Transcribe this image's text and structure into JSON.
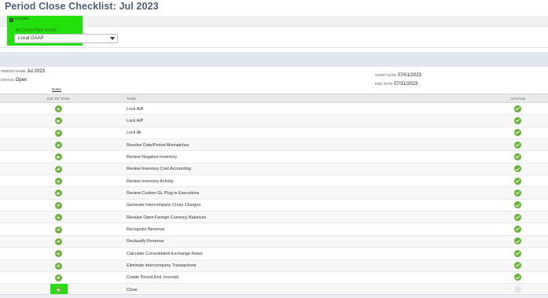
{
  "page": {
    "title": "Period Close Checklist: Jul 2023"
  },
  "filters": {
    "toggle_label": "FILTERS",
    "accounting_book_label": "ACCOUNTING BOOK",
    "accounting_book_value": "Local GAAP",
    "highlight_color": "#22e00c"
  },
  "period": {
    "name_label": "PERIOD NAME",
    "name_value": "Jul 2023",
    "status_label": "STATUS",
    "status_value": "Open",
    "start_label": "START DATE",
    "start_value": "07/01/2023",
    "end_label": "END DATE",
    "end_value": "07/31/2023",
    "notes_label": "Notes"
  },
  "table": {
    "headers": {
      "goto": "GO TO TASK",
      "task": "TASK",
      "status": "STATUS"
    },
    "rows": [
      {
        "task": "Lock A/R",
        "status": "complete"
      },
      {
        "task": "Lock A/P",
        "status": "complete"
      },
      {
        "task": "Lock All",
        "status": "complete"
      },
      {
        "task": "Resolve Date/Period Mismatches",
        "status": "complete"
      },
      {
        "task": "Review Negative Inventory",
        "status": "complete"
      },
      {
        "task": "Review Inventory Cost Accounting",
        "status": "complete"
      },
      {
        "task": "Review Inventory Activity",
        "status": "complete"
      },
      {
        "task": "Review Custom GL Plug-in Executions",
        "status": "complete"
      },
      {
        "task": "Generate Intercompany Cross Charges",
        "status": "complete"
      },
      {
        "task": "Revalue Open Foreign Currency Balances",
        "status": "complete"
      },
      {
        "task": "Recognize Revenue",
        "status": "complete"
      },
      {
        "task": "Reclassify Revenue",
        "status": "complete"
      },
      {
        "task": "Calculate Consolidated Exchange Rates",
        "status": "complete"
      },
      {
        "task": "Eliminate Intercompany Transactions",
        "status": "complete"
      },
      {
        "task": "Create Period End Journals",
        "status": "complete"
      },
      {
        "task": "Close",
        "status": "pending",
        "highlighted": true
      }
    ],
    "icons": {
      "goto": "arrow-right-circle-icon",
      "complete": "check-circle-icon",
      "pending": "empty-circle-icon"
    },
    "colors": {
      "complete": "#62b531",
      "goto": "#6cb43f",
      "pending": "#e4e6e8"
    }
  }
}
